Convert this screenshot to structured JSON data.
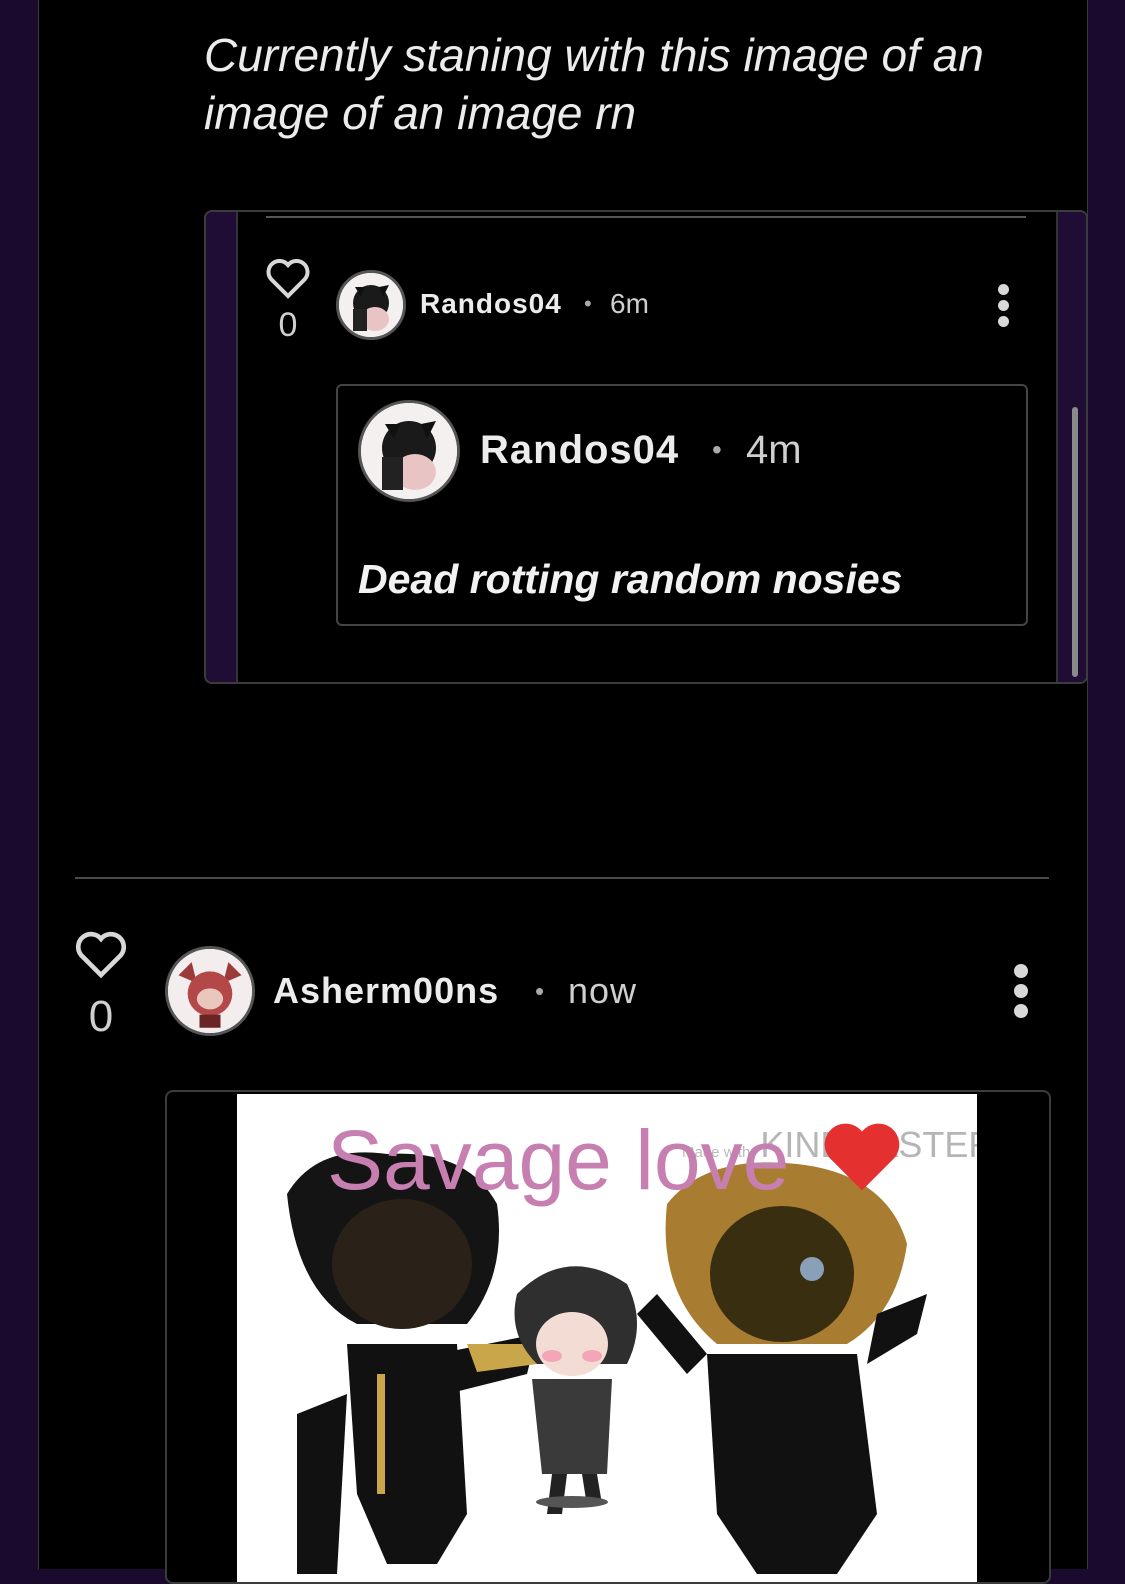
{
  "caption": "Currently staning with this image of an image of an image rn",
  "embedded_comment": {
    "likes": "0",
    "username": "Randos04",
    "separator": "•",
    "time": "6m",
    "quoted": {
      "username": "Randos04",
      "separator": "•",
      "time": "4m",
      "text": "Dead rotting random nosies"
    }
  },
  "comment": {
    "likes": "0",
    "username": "Asherm00ns",
    "separator": "•",
    "time": "now",
    "media": {
      "title_text": "Savage love",
      "watermark_prefix": "Made with",
      "watermark": "KINEMASTER"
    }
  },
  "colors": {
    "panel_bg": "#000000",
    "side_bg": "#1a0b2e",
    "media_title": "#c67fb0"
  }
}
